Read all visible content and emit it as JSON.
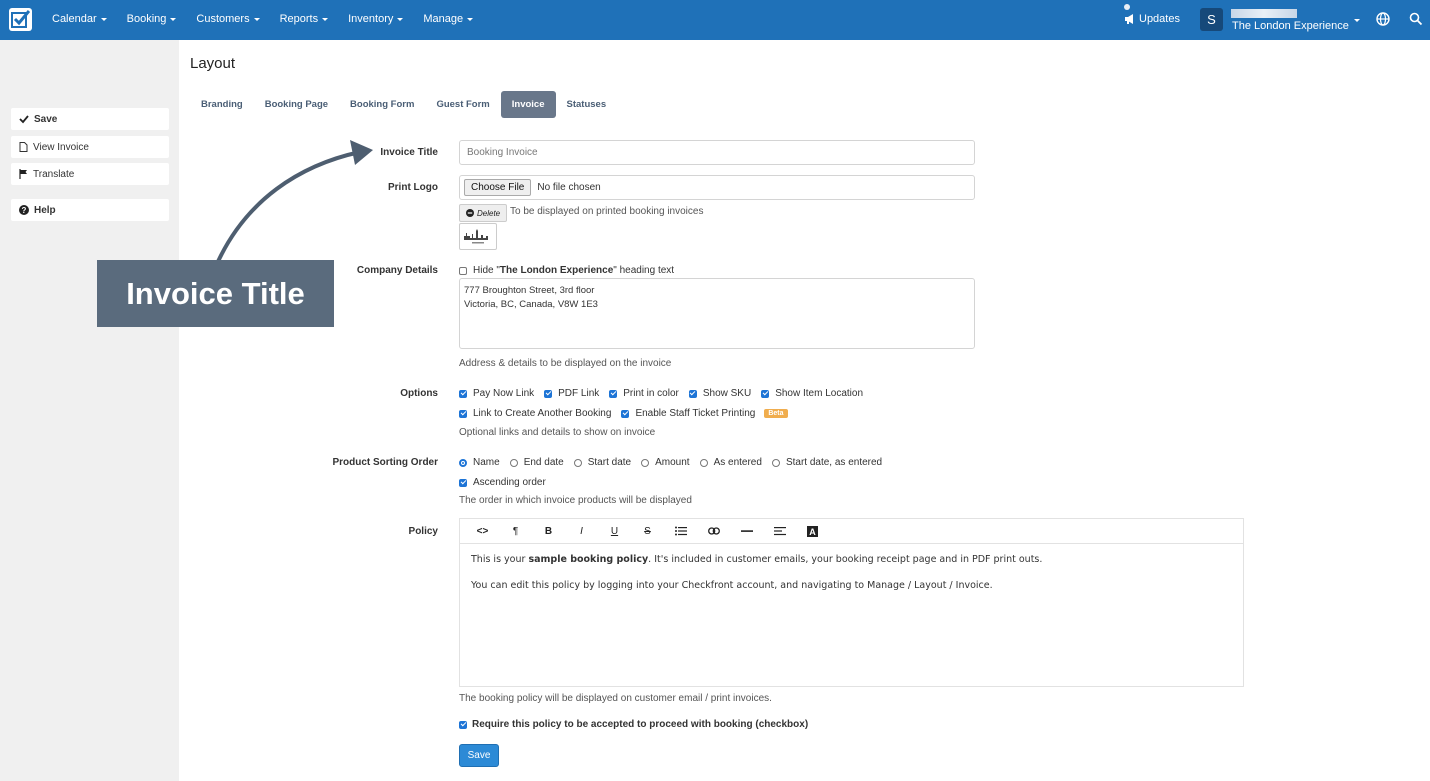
{
  "topbar": {
    "nav": [
      "Calendar",
      "Booking",
      "Customers",
      "Reports",
      "Inventory",
      "Manage"
    ],
    "updates": "Updates",
    "avatar_letter": "S",
    "account_name": "The London Experience"
  },
  "sidebar": {
    "save": "Save",
    "view_invoice": "View Invoice",
    "translate": "Translate",
    "help": "Help"
  },
  "page": {
    "title": "Layout",
    "tabs": [
      "Branding",
      "Booking Page",
      "Booking Form",
      "Guest Form",
      "Invoice",
      "Statuses"
    ],
    "active_tab": "Invoice"
  },
  "form": {
    "invoice_title": {
      "label": "Invoice Title",
      "placeholder": "Booking Invoice"
    },
    "print_logo": {
      "label": "Print Logo",
      "choose": "Choose File",
      "no_file": "No file chosen",
      "delete": "Delete",
      "help": "To be displayed on printed booking invoices"
    },
    "company": {
      "label": "Company Details",
      "hide_prefix": "Hide \"",
      "hide_name": "The London Experience",
      "hide_suffix": "\" heading text",
      "address_line1": "777 Broughton Street, 3rd floor",
      "address_line2": "Victoria, BC, Canada, V8W 1E3",
      "help": "Address & details to be displayed on the invoice"
    },
    "options": {
      "label": "Options",
      "row1": [
        "Pay Now Link",
        "PDF Link",
        "Print in color",
        "Show SKU",
        "Show Item Location"
      ],
      "row2": [
        "Link to Create Another Booking",
        "Enable Staff Ticket Printing"
      ],
      "beta": "Beta",
      "help": "Optional links and details to show on invoice"
    },
    "sorting": {
      "label": "Product Sorting Order",
      "choices": [
        "Name",
        "End date",
        "Start date",
        "Amount",
        "As entered",
        "Start date, as entered"
      ],
      "selected": "Name",
      "ascending": "Ascending order",
      "help": "The order in which invoice products will be displayed"
    },
    "policy": {
      "label": "Policy",
      "p1_before": "This is your ",
      "p1_bold": "sample booking policy",
      "p1_after": ". It's included in customer emails, your booking receipt page and in PDF print outs.",
      "p2": "You can edit this policy by logging into your Checkfront account, and navigating to Manage / Layout / Invoice.",
      "help": "The booking policy will be displayed on customer email / print invoices.",
      "require": "Require this policy to be accepted to proceed with booking (checkbox)"
    },
    "save": "Save"
  },
  "callout": {
    "text": "Invoice Title"
  },
  "colors": {
    "topbar": "#1f71b8",
    "active_tab": "#69778a",
    "primary": "#2c8ad6",
    "callout": "#5a6b7d",
    "beta": "#f0ad4e"
  }
}
